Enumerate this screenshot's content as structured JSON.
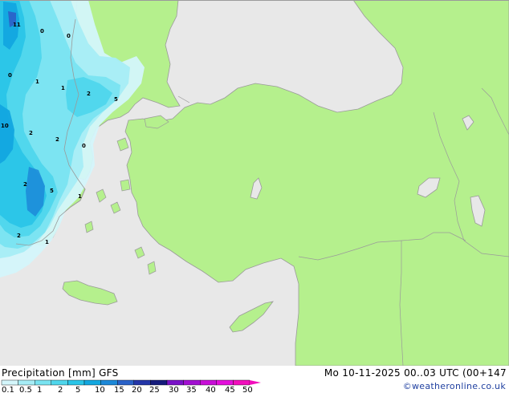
{
  "footer": {
    "title": "Precipitation [mm]  GFS",
    "valid": "Mo 10-11-2025 00..03 UTC (00+147",
    "credit": "©weatheronline.co.uk"
  },
  "legend": {
    "labels": [
      "0.1",
      "0.5",
      "1",
      "2",
      "5",
      "10",
      "15",
      "20",
      "25",
      "30",
      "35",
      "40",
      "45",
      "50"
    ],
    "colors": [
      "#d4f6fb",
      "#a6edf6",
      "#79e3f1",
      "#4fd6ec",
      "#2ac5e8",
      "#12a7e0",
      "#1c88d8",
      "#2a62c8",
      "#2436a8",
      "#151b7c",
      "#7a12c8",
      "#a20fd2",
      "#c80ed8",
      "#e40edc",
      "#f20ebc"
    ]
  },
  "map": {
    "colors": {
      "sea": "#e8e8e8",
      "land": "#b5f08d",
      "coast": "#9a9a9a"
    },
    "labels": [
      {
        "name": "a",
        "text": "11"
      },
      {
        "name": "b",
        "text": "0"
      },
      {
        "name": "c",
        "text": "0"
      },
      {
        "name": "d",
        "text": "0"
      },
      {
        "name": "e",
        "text": "1"
      },
      {
        "name": "f",
        "text": "1"
      },
      {
        "name": "g",
        "text": "2"
      },
      {
        "name": "h",
        "text": "5"
      },
      {
        "name": "i",
        "text": "10"
      },
      {
        "name": "j",
        "text": "2"
      },
      {
        "name": "k",
        "text": "2"
      },
      {
        "name": "l",
        "text": "0"
      },
      {
        "name": "m",
        "text": "2"
      },
      {
        "name": "n",
        "text": "5"
      },
      {
        "name": "o",
        "text": "1"
      },
      {
        "name": "p",
        "text": "2"
      },
      {
        "name": "q",
        "text": "1"
      }
    ]
  }
}
